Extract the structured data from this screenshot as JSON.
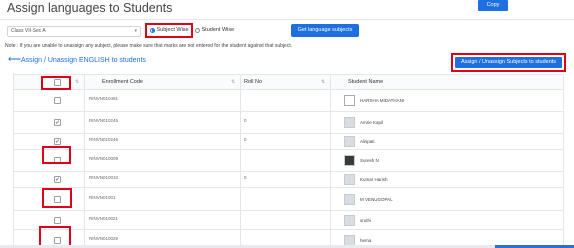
{
  "header": {
    "title": "Assign languages to Students",
    "copy_label": "Copy"
  },
  "filters": {
    "class_value": "Class VII-Sec A",
    "radio_subject_wise": "Subject Wise",
    "radio_student_wise": "Student Wise",
    "selected": "Subject Wise",
    "get_button_label": "Get language subjects"
  },
  "note": "Note : If you are unable to unassign any subject, please make sure that marks are not entered for the student against that subject.",
  "section": {
    "title": "Assign / Unassign ENGLISH to students",
    "assign_button_label": "Assign / Unassign Subjects to students"
  },
  "table": {
    "columns": [
      "",
      "Enrollment Code",
      "Roll No",
      "Student Name"
    ],
    "rows": [
      {
        "checked": false,
        "enrollment": "RINVN010491",
        "roll": "",
        "name": "HARSHA MIDATHANI",
        "avatar": "broken"
      },
      {
        "checked": true,
        "enrollment": "RINVN010245",
        "roll": "0",
        "name": "Amrie Kapil",
        "avatar": "placeholder"
      },
      {
        "checked": true,
        "enrollment": "RINVN010246",
        "roll": "0",
        "name": "Alispati",
        "avatar": "placeholder"
      },
      {
        "checked": false,
        "enrollment": "RINVN010009",
        "roll": "",
        "name": "Suresh N",
        "avatar": "photo"
      },
      {
        "checked": true,
        "enrollment": "RINVN010010",
        "roll": "0",
        "name": "Kumar Harish",
        "avatar": "placeholder"
      },
      {
        "checked": false,
        "enrollment": "RINVN01001",
        "roll": "",
        "name": "M VENUGOPAL",
        "avatar": "placeholder"
      },
      {
        "checked": false,
        "enrollment": "RINVN010021",
        "roll": "",
        "name": "sruthi",
        "avatar": "placeholder"
      },
      {
        "checked": false,
        "enrollment": "RINVN010029",
        "roll": "",
        "name": "hema",
        "avatar": "placeholder"
      }
    ]
  },
  "icons": {
    "back": "arrow-left-icon",
    "sort": "sort-icon",
    "caret": "chevron-down-icon"
  },
  "colors": {
    "accent": "#1e6fe0",
    "highlight": "#e0001a"
  }
}
